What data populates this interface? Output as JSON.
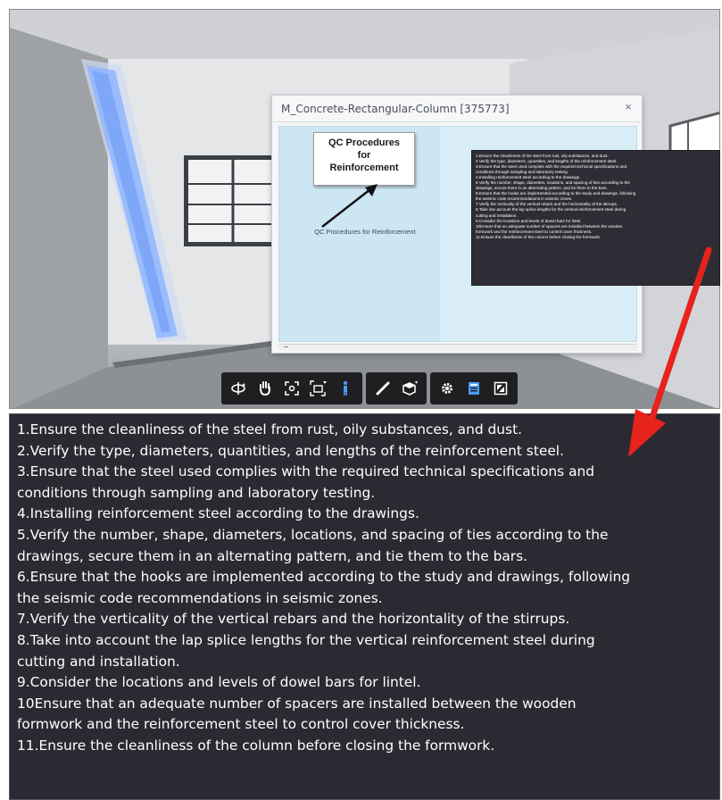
{
  "dialog": {
    "title": "M_Concrete-Rectangular-Column [375773]",
    "close_glyph": "×",
    "qc_box_text": "QC Procedures\nfor\nReinforcement",
    "qc_caption": "QC Procedures for Reinforcement"
  },
  "tooltip": {
    "lines": [
      "1.Ensure the cleanliness of the steel from rust, oily substances, and dust.",
      "2.Verify the type, diameters, quantities, and lengths of the reinforcement steel.",
      "3.Ensure that the steel used complies with the required technical specifications and",
      "conditions through sampling and laboratory testing.",
      "4.Installing reinforcement steel according to the drawings.",
      "5.Verify the number, shape, diameters, locations, and spacing of ties according to the",
      "drawings, secure them in an alternating pattern, and tie them to the bars.",
      "6.Ensure that the hooks are implemented according to the study and drawings, following",
      "the seismic code recommendations in seismic zones.",
      "7.Verify the verticality of the vertical rebars and the horizontality of the stirrups.",
      "8.Take into account the lap splice lengths for the vertical reinforcement steel during",
      "cutting and installation.",
      "9.Consider the locations and levels of dowel bars for lintel.",
      "10Ensure that an adequate number of spacers are installed between the wooden",
      "formwork and the reinforcement steel to control cover thickness.",
      "11.Ensure the cleanliness of the column before closing the formwork."
    ]
  },
  "toolbar": {
    "icons": [
      "orbit-icon",
      "pan-hand-icon",
      "zoom-fit-icon",
      "camera-icon",
      "walk-person-icon",
      "measure-icon",
      "section-box-icon",
      "settings-icon",
      "properties-icon",
      "fullscreen-icon"
    ]
  },
  "panel": {
    "lines": [
      "1.Ensure the cleanliness of the steel from rust, oily substances, and dust.",
      "2.Verify the type, diameters, quantities, and lengths of the reinforcement steel.",
      "3.Ensure that the steel used complies with the required technical specifications and",
      "conditions through sampling and laboratory testing.",
      "4.Installing reinforcement steel according to the drawings.",
      "5.Verify the number, shape, diameters, locations, and spacing of ties according to the",
      "drawings, secure them in an alternating pattern, and tie them to the bars.",
      "6.Ensure that the hooks are implemented according to the study and drawings, following",
      "the seismic code recommendations in seismic zones.",
      "7.Verify the verticality of the vertical rebars and the horizontality of the stirrups.",
      "8.Take into account the lap splice lengths for the vertical reinforcement steel during",
      "cutting and installation.",
      "9.Consider the locations and levels of dowel bars for lintel.",
      "10Ensure that an adequate number of spacers are installed between the wooden",
      "formwork and the reinforcement steel to control cover thickness.",
      "11.Ensure the cleanliness of the column before closing the formwork."
    ]
  },
  "colors": {
    "selected_column": "#8fb6ff",
    "panel_bg": "#2b2a33",
    "arrow_red": "#e8231d"
  }
}
